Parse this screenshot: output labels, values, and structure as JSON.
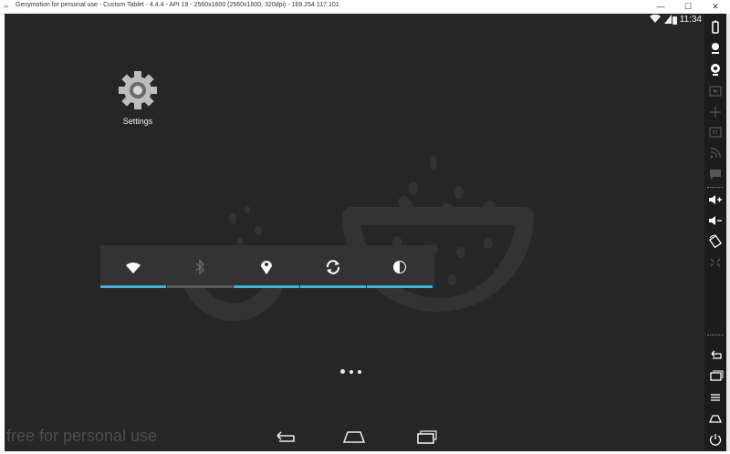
{
  "window": {
    "title": "Genymotion for personal use - Custom Tablet - 4.4.4 - API 19 - 2560x1600 (2560x1600, 320dpi) - 169.254.117.101",
    "minimize": "—",
    "maximize": "☐",
    "close": "✕"
  },
  "status_bar": {
    "time": "11:34",
    "icons": [
      "wifi-icon",
      "signal-icon",
      "battery-icon"
    ]
  },
  "home": {
    "apps": [
      {
        "label": "Settings",
        "icon": "gear-icon"
      }
    ],
    "pager": {
      "pages": 3,
      "current": 1
    }
  },
  "power_widget": {
    "toggles": [
      {
        "name": "wifi",
        "icon": "wifi-icon",
        "enabled": true
      },
      {
        "name": "bluetooth",
        "icon": "bluetooth-icon",
        "enabled": false
      },
      {
        "name": "location",
        "icon": "location-icon",
        "enabled": true
      },
      {
        "name": "sync",
        "icon": "sync-icon",
        "enabled": true
      },
      {
        "name": "brightness",
        "icon": "brightness-icon",
        "enabled": true
      }
    ],
    "on_color": "#33b5e5",
    "off_color": "#5a5a5a"
  },
  "nav_bar": {
    "buttons": [
      "back-icon",
      "home-icon",
      "recent-apps-icon"
    ]
  },
  "watermark": "free for personal use",
  "sidebar": {
    "tools": [
      "battery-icon",
      "gps-icon",
      "camera-icon",
      "screencast-icon",
      "move-icon",
      "id-icon",
      "rss-icon",
      "sms-icon",
      "volume-up-icon",
      "volume-down-icon",
      "rotate-icon",
      "pixel-icon",
      "back-icon",
      "menu-icon",
      "recent-icon",
      "home-icon",
      "power-icon"
    ]
  }
}
